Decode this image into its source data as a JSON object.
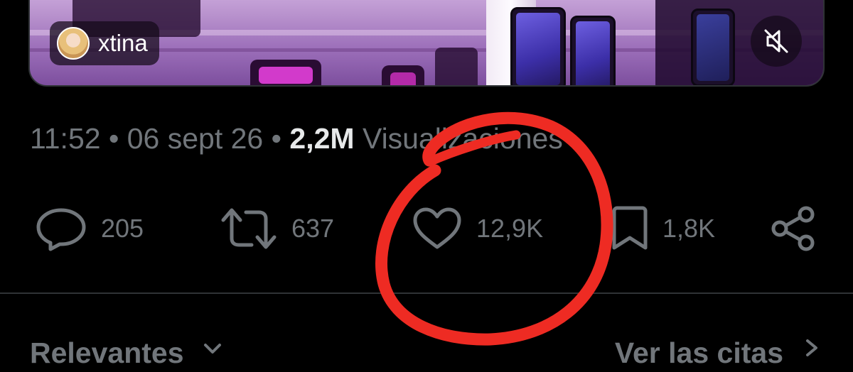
{
  "video": {
    "user_name": "xtina",
    "avatar_icon": "avatar-image",
    "mute_icon": "speaker-muted-icon"
  },
  "meta": {
    "time": "11:52",
    "separator": "•",
    "date": "06 sept 26",
    "views_count": "2,2M",
    "views_label": "Visualizaciones"
  },
  "actions": {
    "replies": {
      "icon": "reply-bubble-icon",
      "count": "205"
    },
    "reposts": {
      "icon": "repost-icon",
      "count": "637"
    },
    "likes": {
      "icon": "heart-icon",
      "count": "12,9K"
    },
    "bookmarks": {
      "icon": "bookmark-icon",
      "count": "1,8K"
    },
    "share": {
      "icon": "share-icon"
    }
  },
  "bottom": {
    "relevant_label": "Relevantes",
    "quotes_label": "Ver las citas"
  },
  "colors": {
    "background": "#000000",
    "muted_text": "#71767b",
    "bright_text": "#e7e9ea",
    "divider": "#2f3336",
    "annotation_red": "#ee2b23"
  }
}
